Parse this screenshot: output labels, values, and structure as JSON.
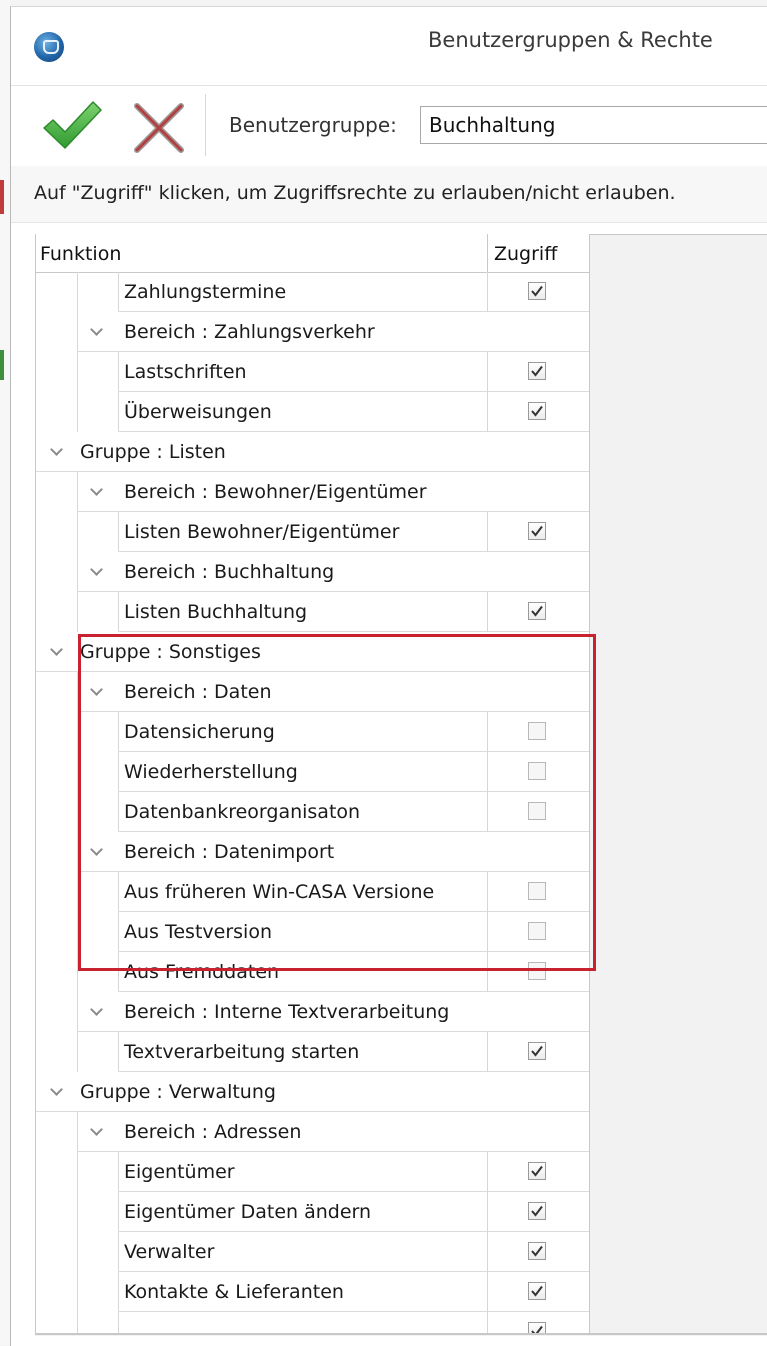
{
  "window": {
    "title": "Benutzergruppen & Rechte"
  },
  "toolbar": {
    "confirm_icon": "checkmark-icon",
    "cancel_icon": "close-icon",
    "group_label": "Benutzergruppe:",
    "group_value": "Buchhaltung"
  },
  "info": {
    "text": "Auf \"Zugriff\" klicken, um Zugriffsrechte zu erlauben/nicht erlauben."
  },
  "grid": {
    "columns": {
      "function": "Funktion",
      "access": "Zugriff"
    },
    "rows": [
      {
        "level": 2,
        "label": "Zahlungstermine",
        "checked": true
      },
      {
        "level": 1,
        "label": "Bereich : Zahlungsverkehr",
        "expanded": true
      },
      {
        "level": 2,
        "label": "Lastschriften",
        "checked": true
      },
      {
        "level": 2,
        "label": "Überweisungen",
        "checked": true
      },
      {
        "level": 0,
        "label": "Gruppe : Listen",
        "expanded": true
      },
      {
        "level": 1,
        "label": "Bereich : Bewohner/Eigentümer",
        "expanded": true
      },
      {
        "level": 2,
        "label": "Listen Bewohner/Eigentümer",
        "checked": true
      },
      {
        "level": 1,
        "label": "Bereich : Buchhaltung",
        "expanded": true
      },
      {
        "level": 2,
        "label": "Listen Buchhaltung",
        "checked": true
      },
      {
        "level": 0,
        "label": "Gruppe : Sonstiges",
        "expanded": true
      },
      {
        "level": 1,
        "label": "Bereich : Daten",
        "expanded": true
      },
      {
        "level": 2,
        "label": "Datensicherung",
        "checked": false
      },
      {
        "level": 2,
        "label": "Wiederherstellung",
        "checked": false
      },
      {
        "level": 2,
        "label": "Datenbankreorganisaton",
        "checked": false
      },
      {
        "level": 1,
        "label": "Bereich : Datenimport",
        "expanded": true
      },
      {
        "level": 2,
        "label": "Aus früheren Win-CASA Versione",
        "checked": false
      },
      {
        "level": 2,
        "label": "Aus Testversion",
        "checked": false
      },
      {
        "level": 2,
        "label": "Aus Fremddaten",
        "checked": false
      },
      {
        "level": 1,
        "label": "Bereich : Interne Textverarbeitung",
        "expanded": true
      },
      {
        "level": 2,
        "label": "Textverarbeitung starten",
        "checked": true
      },
      {
        "level": 0,
        "label": "Gruppe : Verwaltung",
        "expanded": true
      },
      {
        "level": 1,
        "label": "Bereich : Adressen",
        "expanded": true
      },
      {
        "level": 2,
        "label": "Eigentümer",
        "checked": true
      },
      {
        "level": 2,
        "label": "Eigentümer Daten ändern",
        "checked": true
      },
      {
        "level": 2,
        "label": "Verwalter",
        "checked": true
      },
      {
        "level": 2,
        "label": "Kontakte & Lieferanten",
        "checked": true
      },
      {
        "level": 2,
        "label": "",
        "checked": true
      }
    ]
  },
  "colors": {
    "highlight": "#c8212f",
    "check_green": "#4fb24a",
    "cancel_red": "#b5403f"
  }
}
